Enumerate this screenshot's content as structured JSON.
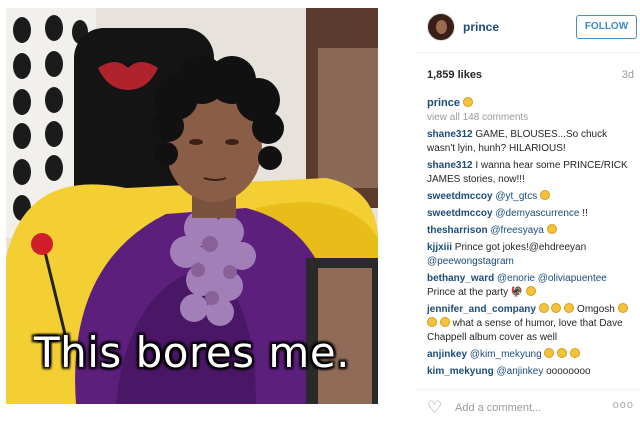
{
  "post": {
    "overlay_text": "This bores me."
  },
  "header": {
    "username": "prince",
    "follow_label": "FOLLOW"
  },
  "stats": {
    "likes": "1,859 likes",
    "age": "3d"
  },
  "caption": {
    "username": "prince"
  },
  "view_all": "view all 148 comments",
  "comments": [
    {
      "user": "shane312",
      "text": "GAME, BLOUSES...So chuck wasn't lyin, hunh? HILARIOUS!"
    },
    {
      "user": "shane312",
      "text": "I wanna hear some PRINCE/RICK JAMES stories, now!!!"
    },
    {
      "user": "sweetdmccoy",
      "mention": "@yt_gtcs",
      "text": ""
    },
    {
      "user": "sweetdmccoy",
      "mention": "@demyascurrence",
      "text": "!!"
    },
    {
      "user": "thesharrison",
      "mention": "@freesyaya",
      "text": ""
    },
    {
      "user": "kjjxiii",
      "text": "Prince got jokes!@ehdreeyan",
      "mention2": "@peewongstagram"
    },
    {
      "user": "bethany_ward",
      "mention": "@enorie",
      "mention2": "@oliviapuentee",
      "text": "Prince at the party 🦃"
    },
    {
      "user": "jennifer_and_company",
      "text": "Omgosh",
      "text2": "what a sense of humor, love that Dave Chappell album cover as well"
    },
    {
      "user": "anjinkey",
      "mention": "@kim_mekyung",
      "text": ""
    },
    {
      "user": "kim_mekyung",
      "mention": "@anjinkey",
      "text": "oooooooo"
    }
  ],
  "footer": {
    "add_comment_placeholder": "Add a comment...",
    "more_label": "ooo"
  },
  "colors": {
    "link": "#1b4c7a",
    "follow": "#3f8ac4",
    "muted": "#999999"
  }
}
